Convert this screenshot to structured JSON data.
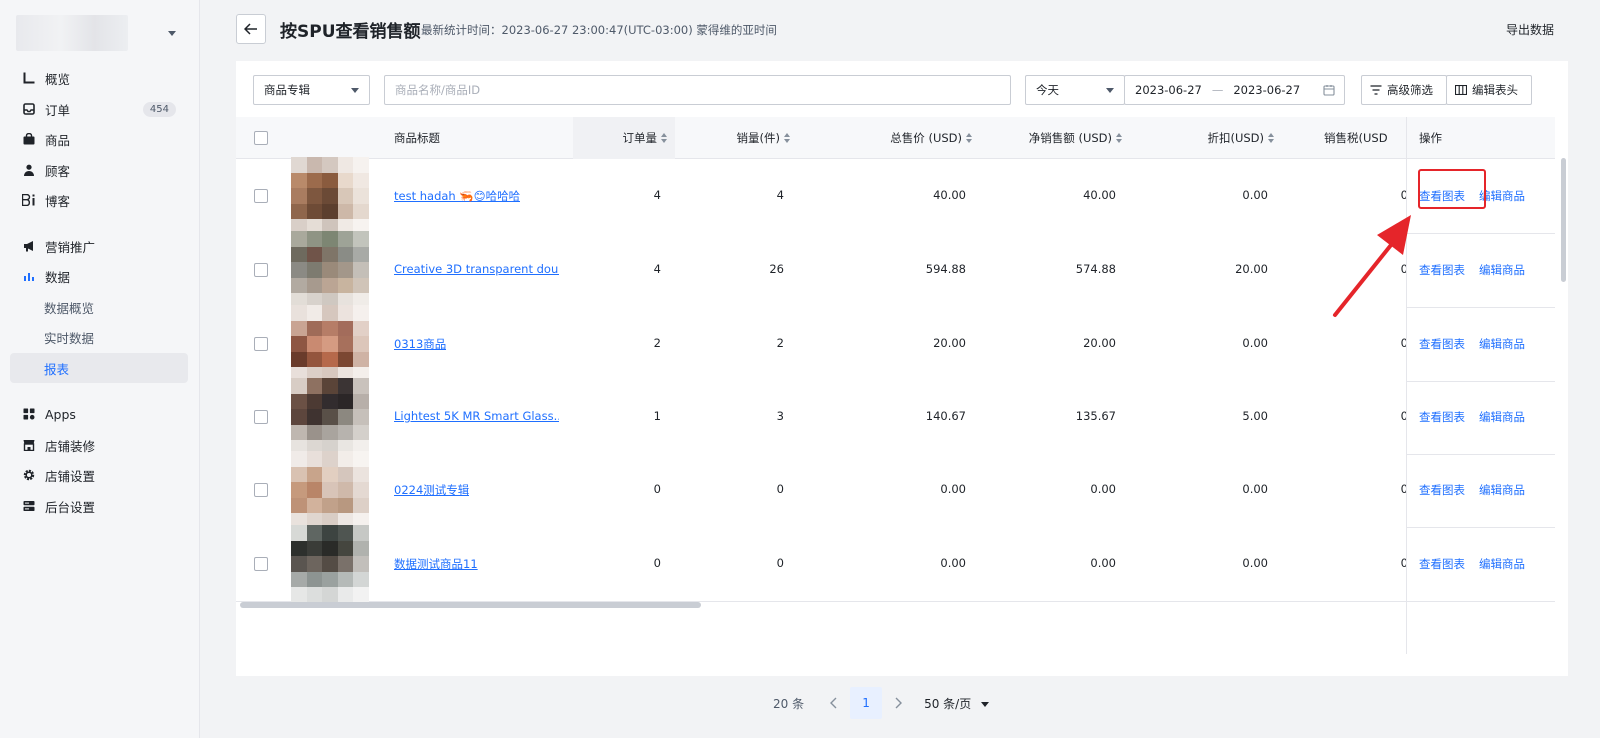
{
  "sidebar": {
    "items": [
      {
        "label": "概览",
        "icon": "chart-icon"
      },
      {
        "label": "订单",
        "icon": "inbox-icon",
        "badge": "454"
      },
      {
        "label": "商品",
        "icon": "bag-icon"
      },
      {
        "label": "顾客",
        "icon": "user-icon"
      },
      {
        "label": "博客",
        "icon": "blog-icon"
      },
      {
        "label": "营销推广",
        "icon": "megaphone-icon"
      },
      {
        "label": "数据",
        "icon": "bar-chart-icon"
      },
      {
        "label": "数据概览",
        "sub": true
      },
      {
        "label": "实时数据",
        "sub": true
      },
      {
        "label": "报表",
        "sub": true,
        "active": true
      },
      {
        "label": "Apps",
        "icon": "apps-icon"
      },
      {
        "label": "店铺装修",
        "icon": "store-icon"
      },
      {
        "label": "店铺设置",
        "icon": "gear-icon"
      },
      {
        "label": "后台设置",
        "icon": "server-icon"
      }
    ]
  },
  "header": {
    "title": "按SPU查看销售额",
    "stat_time": "最新统计时间：2023-06-27 23:00:47(UTC-03:00) 蒙得维的亚时间",
    "export_label": "导出数据"
  },
  "filters": {
    "collection_select": "商品专辑",
    "search_placeholder": "商品名称/商品ID",
    "period_select": "今天",
    "date_start": "2023-06-27",
    "date_sep": "—",
    "date_end": "2023-06-27",
    "advanced_filter": "高级筛选",
    "edit_columns": "编辑表头"
  },
  "table": {
    "columns": {
      "title": "商品标题",
      "orders": "订单量",
      "sales_qty": "销量(件)",
      "gross": "总售价 (USD)",
      "net": "净销售额 (USD)",
      "discount": "折扣(USD)",
      "tax": "销售税(USD",
      "ops": "操作"
    },
    "rows": [
      {
        "title": "test hadah 🦐😊哈哈哈",
        "orders": "4",
        "qty": "4",
        "gross": "40.00",
        "net": "40.00",
        "discount": "0.00",
        "tax": "0"
      },
      {
        "title": "Creative 3D transparent dou...",
        "orders": "4",
        "qty": "26",
        "gross": "594.88",
        "net": "574.88",
        "discount": "20.00",
        "tax": "0"
      },
      {
        "title": "0313商品",
        "orders": "2",
        "qty": "2",
        "gross": "20.00",
        "net": "20.00",
        "discount": "0.00",
        "tax": "0"
      },
      {
        "title": "Lightest 5K MR Smart Glass...",
        "orders": "1",
        "qty": "3",
        "gross": "140.67",
        "net": "135.67",
        "discount": "5.00",
        "tax": "0"
      },
      {
        "title": "0224测试专辑",
        "orders": "0",
        "qty": "0",
        "gross": "0.00",
        "net": "0.00",
        "discount": "0.00",
        "tax": "0"
      },
      {
        "title": "数据测试商品11",
        "orders": "0",
        "qty": "0",
        "gross": "0.00",
        "net": "0.00",
        "discount": "0.00",
        "tax": "0"
      }
    ],
    "op_view_chart": "查看图表",
    "op_edit_product": "编辑商品"
  },
  "pagination": {
    "total": "20 条",
    "current_page": "1",
    "page_size": "50 条/页"
  },
  "colors": {
    "accent": "#1f6fff",
    "highlight": "#e5252a"
  }
}
